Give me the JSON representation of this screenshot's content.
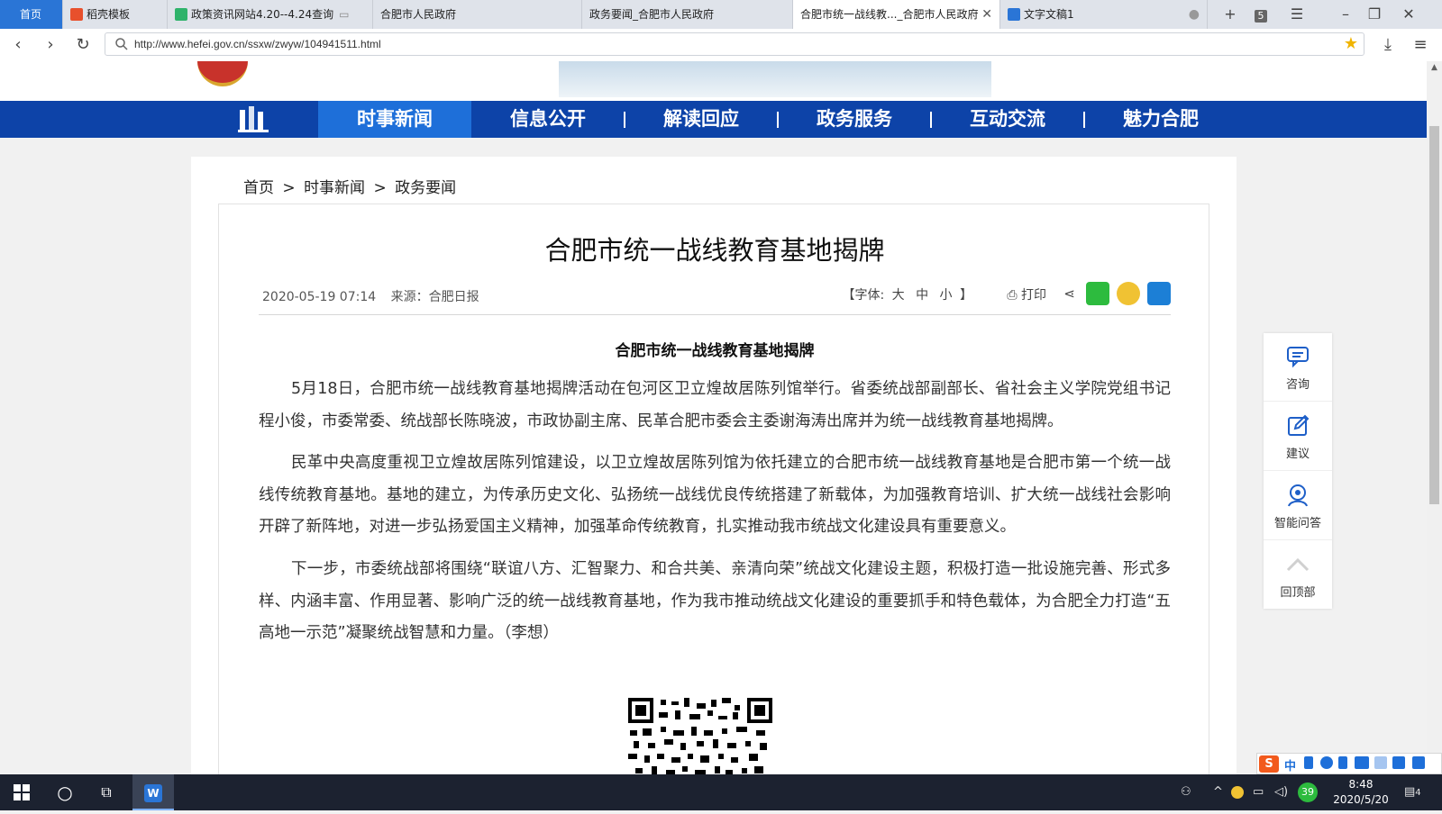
{
  "browser": {
    "tabs": [
      {
        "label": "首页",
        "kind": "home"
      },
      {
        "label": "稻壳模板",
        "kind": "normal"
      },
      {
        "label": "政策资讯网站4.20--4.24查询",
        "kind": "normal"
      },
      {
        "label": "合肥市人民政府",
        "kind": "normal"
      },
      {
        "label": "政务要闻_合肥市人民政府",
        "kind": "normal"
      },
      {
        "label": "合肥市统一战线教..._合肥市人民政府",
        "kind": "active"
      },
      {
        "label": "文字文稿1",
        "kind": "normal"
      }
    ],
    "tab_count": "5",
    "url": "http://www.hefei.gov.cn/ssxw/zwyw/104941511.html",
    "add_tab": "+"
  },
  "site": {
    "nav": [
      "时事新闻",
      "信息公开",
      "解读回应",
      "政务服务",
      "互动交流",
      "魅力合肥"
    ],
    "active_nav": 0
  },
  "breadcrumb": [
    "首页",
    ">",
    "时事新闻",
    ">",
    "政务要闻"
  ],
  "article": {
    "title": "合肥市统一战线教育基地揭牌",
    "date": "2020-05-19 07:14",
    "source": "来源：合肥日报",
    "font_label_open": "【字体:",
    "font_sizes": [
      "大",
      "中",
      "小"
    ],
    "font_label_close": "】",
    "print_label": "打印",
    "subtitle": "合肥市统一战线教育基地揭牌",
    "paragraphs": [
      "5月18日，合肥市统一战线教育基地揭牌活动在包河区卫立煌故居陈列馆举行。省委统战部副部长、省社会主义学院党组书记程小俊，市委常委、统战部长陈晓波，市政协副主席、民革合肥市委会主委谢海涛出席并为统一战线教育基地揭牌。",
      "民革中央高度重视卫立煌故居陈列馆建设，以卫立煌故居陈列馆为依托建立的合肥市统一战线教育基地是合肥市第一个统一战线传统教育基地。基地的建立，为传承历史文化、弘扬统一战线优良传统搭建了新载体，为加强教育培训、扩大统一战线社会影响开辟了新阵地，对进一步弘扬爱国主义精神，加强革命传统教育，扎实推动我市统战文化建设具有重要意义。",
      "下一步，市委统战部将围绕“联谊八方、汇智聚力、和合共美、亲清向荣”统战文化建设主题，积极打造一批设施完善、形式多样、内涵丰富、作用显著、影响广泛的统一战线教育基地，作为我市推动统战文化建设的重要抓手和特色载体，为合肥全力打造“五高地一示范”凝聚统战智慧和力量。（李想）"
    ]
  },
  "sidebar": [
    "咨询",
    "建议",
    "智能问答",
    "回顶部"
  ],
  "ime": {
    "label": "中"
  },
  "taskbar": {
    "time": "8:48",
    "date": "2020/5/20",
    "badge_temp": "39",
    "notify_count": "4"
  },
  "colors": {
    "nav_bg": "#0d43a8",
    "nav_active": "#1e6fd9",
    "home_tab": "#2a75d6"
  }
}
